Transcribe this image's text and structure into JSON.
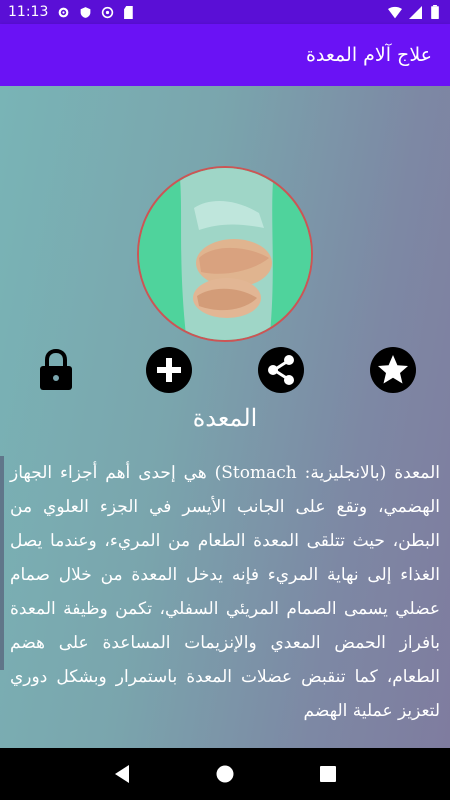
{
  "status": {
    "time": "11:13"
  },
  "app": {
    "title": "علاج آلام المعدة"
  },
  "article": {
    "title": "المعدة",
    "body": "المعدة (بالانجليزية: Stomach) هي إحدى أهم أجزاء الجهاز الهضمي، وتقع على الجانب الأيسر في الجزء العلوي من البطن، حيث تتلقى المعدة الطعام من المريء، وعندما يصل الغذاء إلى نهاية المريء فإنه يدخل المعدة من خلال صمام عضلي يسمى الصمام المريئي السفلي، تكمن وظيفة المعدة بافراز الحمض المعدي والإنزيمات المساعدة على هضم الطعام، كما تنقبض عضلات المعدة باستمرار وبشكل دوري لتعزيز عملية الهضم"
  },
  "actions": {
    "lock": "lock-icon",
    "add": "add-circle-icon",
    "share": "share-icon",
    "favorite": "star-icon"
  },
  "colors": {
    "status_bar": "#5a0fd6",
    "app_bar": "#6a12f5",
    "gradient_start": "#79b4b6",
    "gradient_end": "#7f7c9f"
  }
}
